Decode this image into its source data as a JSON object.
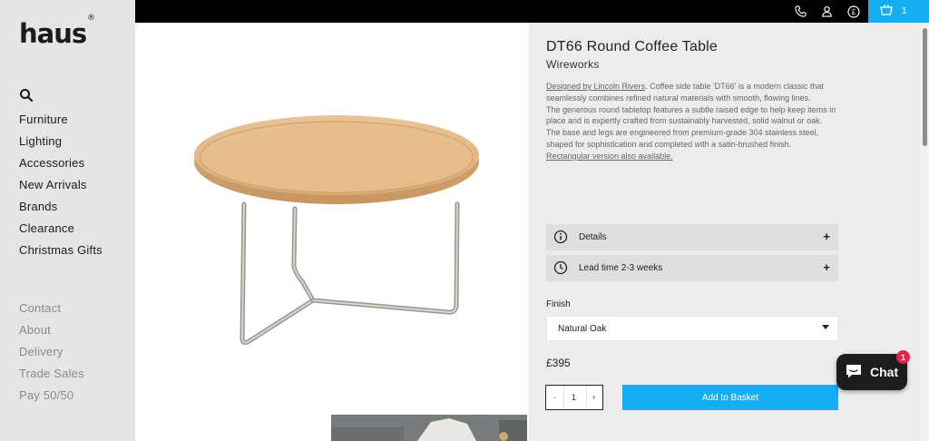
{
  "logo": {
    "text": "haus",
    "reg": "®"
  },
  "nav": {
    "primary": [
      "Furniture",
      "Lighting",
      "Accessories",
      "New Arrivals",
      "Brands",
      "Clearance",
      "Christmas Gifts"
    ],
    "secondary": [
      "Contact",
      "About",
      "Delivery",
      "Trade Sales",
      "Pay 50/50"
    ]
  },
  "topbar": {
    "cart_count": "1"
  },
  "product": {
    "title": "DT66 Round Coffee Table",
    "brand": "Wireworks",
    "description": {
      "p1_link": "Designed by Lincoln Rivers",
      "p1_rest": ". Coffee side table 'DT66' is a modern classic that seamlessly combines refined natural materials with smooth, flowing lines.",
      "p2": "The generous round tabletop features a subtle raised edge to help keep items in place and is expertly crafted from sustainably harvested, solid walnut or oak.",
      "p3": "The base and legs are engineered from premium-grade 304 stainless steel, shaped for sophistication and completed with a satin-brushed finish.",
      "p4_link": "Rectangular version also available."
    },
    "accordion": [
      {
        "label": "Details",
        "icon": "info-icon",
        "toggle": "+"
      },
      {
        "label": "Lead time 2-3 weeks",
        "icon": "clock-icon",
        "toggle": "+"
      }
    ],
    "finish_label": "Finish",
    "finish_value": "Natural Oak",
    "price": "£395",
    "qty": {
      "minus": "-",
      "value": "1",
      "plus": "+"
    },
    "add_to_basket": "Add to Basket"
  },
  "chat": {
    "label": "Chat",
    "badge": "1"
  },
  "colors": {
    "accent": "#15aef2",
    "topbar": "#000000",
    "sidebar": "#e5e5e5",
    "chat_badge": "#e0264a"
  }
}
